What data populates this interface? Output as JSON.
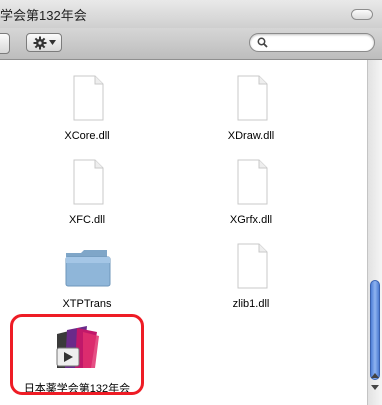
{
  "window": {
    "title": "学会第132年会"
  },
  "toolbar": {
    "action_icon": "gear-icon",
    "search": {
      "value": "",
      "placeholder": ""
    }
  },
  "files": [
    {
      "name": "XCore.dll",
      "icon": "document-icon"
    },
    {
      "name": "XDraw.dll",
      "icon": "document-icon"
    },
    {
      "name": "XFC.dll",
      "icon": "document-icon"
    },
    {
      "name": "XGrfx.dll",
      "icon": "document-icon"
    },
    {
      "name": "XTPTrans",
      "icon": "folder-icon"
    },
    {
      "name": "zlib1.dll",
      "icon": "document-icon"
    },
    {
      "name": "日本薬学会第132年会",
      "icon": "app-icon"
    }
  ],
  "colors": {
    "highlight": "#ee1c25",
    "scroll_thumb": "#5b8ad8"
  }
}
